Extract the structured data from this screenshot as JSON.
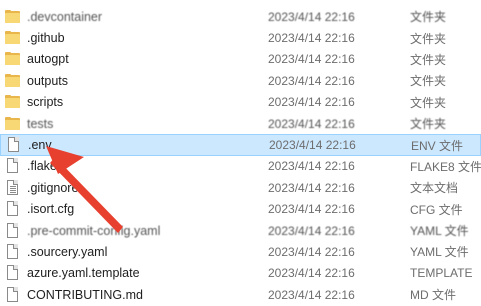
{
  "rows": [
    {
      "name": ".devcontainer",
      "date": "2023/4/14 22:16",
      "type": "文件夹",
      "icon": "folder-icon",
      "blurred": true
    },
    {
      "name": ".github",
      "date": "2023/4/14 22:16",
      "type": "文件夹",
      "icon": "folder-icon"
    },
    {
      "name": "autogpt",
      "date": "2023/4/14 22:16",
      "type": "文件夹",
      "icon": "folder-icon"
    },
    {
      "name": "outputs",
      "date": "2023/4/14 22:16",
      "type": "文件夹",
      "icon": "folder-icon"
    },
    {
      "name": "scripts",
      "date": "2023/4/14 22:16",
      "type": "文件夹",
      "icon": "folder-icon"
    },
    {
      "name": "tests",
      "date": "2023/4/14 22:16",
      "type": "文件夹",
      "icon": "folder-icon",
      "blurred": true
    },
    {
      "name": ".env",
      "date": "2023/4/14 22:16",
      "type": "ENV 文件",
      "icon": "file-icon",
      "selected": true
    },
    {
      "name": ".flake8",
      "date": "2023/4/14 22:16",
      "type": "FLAKE8 文件",
      "icon": "file-icon"
    },
    {
      "name": ".gitignore",
      "date": "2023/4/14 22:16",
      "type": "文本文档",
      "icon": "text-file-icon"
    },
    {
      "name": ".isort.cfg",
      "date": "2023/4/14 22:16",
      "type": "CFG 文件",
      "icon": "file-icon"
    },
    {
      "name": ".pre-commit-config.yaml",
      "date": "2023/4/14 22:16",
      "type": "YAML 文件",
      "icon": "file-icon",
      "blurred": true
    },
    {
      "name": ".sourcery.yaml",
      "date": "2023/4/14 22:16",
      "type": "YAML 文件",
      "icon": "file-icon"
    },
    {
      "name": "azure.yaml.template",
      "date": "2023/4/14 22:16",
      "type": "TEMPLATE",
      "icon": "file-icon"
    },
    {
      "name": "CONTRIBUTING.md",
      "date": "2023/4/14 22:16",
      "type": "MD 文件",
      "icon": "file-icon"
    }
  ],
  "colors": {
    "selected_bg": "#cce8ff",
    "selected_border": "#99d1ff",
    "arrow": "#e8402f",
    "folder": "#f8d775"
  }
}
